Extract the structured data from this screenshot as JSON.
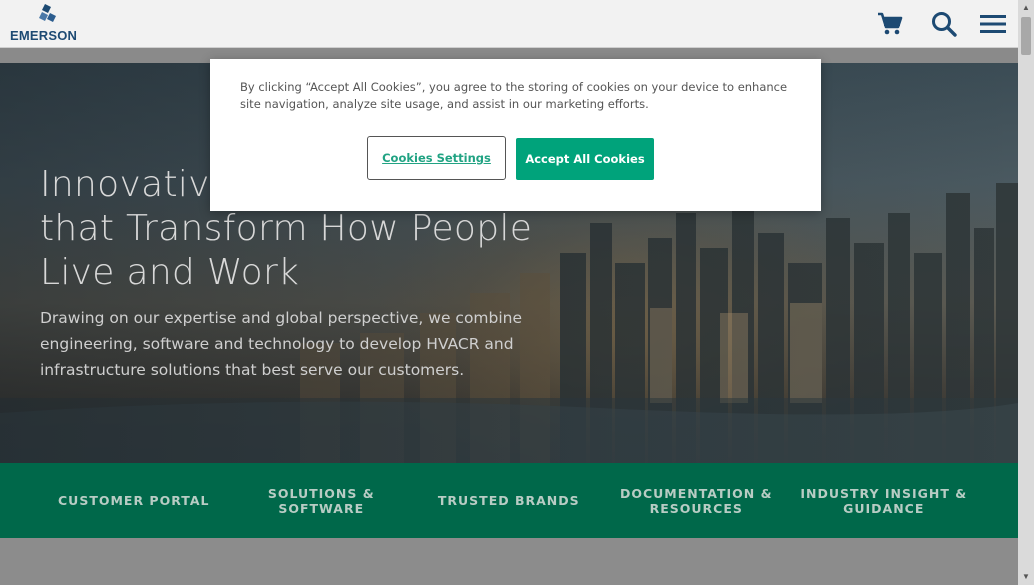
{
  "header": {
    "logo_text": "EMERSON",
    "icons": [
      "cart-icon",
      "search-icon",
      "menu-icon"
    ],
    "icon_color": "#1d4a73"
  },
  "hero": {
    "title": "Innovative Solutions that Transform How People Live and Work",
    "title_visible_line1": "Innovative",
    "title_line2": "that Transform How People",
    "title_line3": "Live and Work",
    "subtitle": "Drawing on our expertise and global perspective, we combine engineering, software and technology to develop HVACR and infrastructure solutions that best serve our customers."
  },
  "nav": {
    "items": [
      {
        "label_line1": "CUSTOMER PORTAL",
        "label_line2": ""
      },
      {
        "label_line1": "SOLUTIONS &",
        "label_line2": "SOFTWARE"
      },
      {
        "label_line1": "TRUSTED BRANDS",
        "label_line2": ""
      },
      {
        "label_line1": "DOCUMENTATION &",
        "label_line2": "RESOURCES"
      },
      {
        "label_line1": "INDUSTRY INSIGHT &",
        "label_line2": "GUIDANCE"
      }
    ],
    "background": "#00684a"
  },
  "cookie_banner": {
    "text": "By clicking “Accept All Cookies”, you agree to the storing of cookies on your device to enhance site navigation, analyze site usage, and assist in our marketing efforts.",
    "settings_label": "Cookies Settings",
    "accept_label": "Accept All Cookies",
    "accent": "#00a37b"
  }
}
